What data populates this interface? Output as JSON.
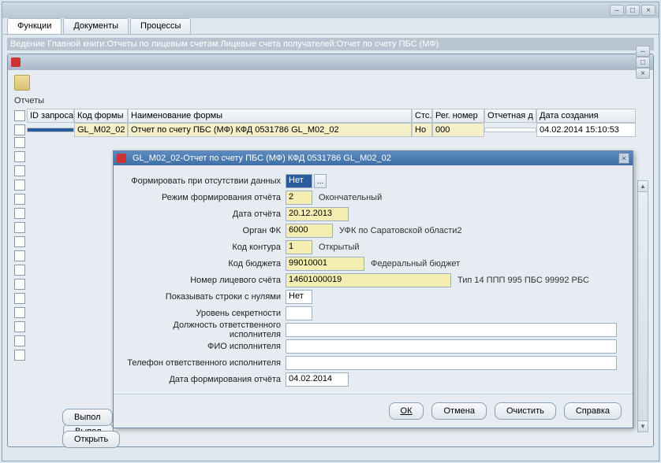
{
  "outer_window": {
    "title": ""
  },
  "tabs": [
    {
      "label": "Функции",
      "active": true
    },
    {
      "label": "Документы",
      "active": false
    },
    {
      "label": "Процессы",
      "active": false
    }
  ],
  "breadcrumb": "Ведение Главной книги:Отчеты по лицевым счетам:Лицевые счета получателей:Отчет по счету ПБС (МФ)",
  "inner_window": {
    "title": ""
  },
  "section_title": "Отчеты",
  "grid": {
    "headers": {
      "id": "ID запроса",
      "code": "Код формы",
      "name": "Наименование формы",
      "status": "Стс.",
      "reg": "Рег. номер",
      "rdate": "Отчетная д",
      "cdate": "Дата создания"
    },
    "row": {
      "id": "",
      "code": "GL_M02_02",
      "name": "Отчет по счету ПБС (МФ) КФД 0531786 GL_M02_02",
      "status": "Но",
      "reg": "000",
      "rdate": "",
      "cdate": "04.02.2014 15:10:53"
    }
  },
  "dialog": {
    "title": "GL_M02_02-Отчет по счету ПБС (МФ) КФД 0531786 GL_M02_02",
    "fields": {
      "form_on_absence": {
        "label": "Формировать при отсутствии данных",
        "value": "Нет"
      },
      "mode": {
        "label": "Режим формирования отчёта",
        "value": "2",
        "descr": "Окончательный"
      },
      "report_date": {
        "label": "Дата отчёта",
        "value": "20.12.2013"
      },
      "organ": {
        "label": "Орган ФК",
        "value": "6000",
        "descr": "УФК по Саратовской области2"
      },
      "contour": {
        "label": "Код контура",
        "value": "1",
        "descr": "Открытый"
      },
      "budget": {
        "label": "Код бюджета",
        "value": "99010001",
        "descr": "Федеральный бюджет"
      },
      "account": {
        "label": "Номер лицевого счёта",
        "value": "14601000019",
        "descr": "Тип 14 ППП 995 ПБС 99992 РБС"
      },
      "show_zero": {
        "label": "Показывать строки с нулями",
        "value": "Нет"
      },
      "secrecy": {
        "label": "Уровень секретности",
        "value": ""
      },
      "exec_post": {
        "label": "Должность ответственного исполнителя",
        "value": ""
      },
      "exec_name": {
        "label": "ФИО исполнителя",
        "value": ""
      },
      "exec_phone": {
        "label": "Телефон ответственного исполнителя",
        "value": ""
      },
      "form_date": {
        "label": "Дата формирования отчёта",
        "value": "04.02.2014"
      }
    },
    "buttons": {
      "ok": "ОК",
      "cancel": "Отмена",
      "clear": "Очистить",
      "help": "Справка"
    }
  },
  "bottom_buttons": {
    "exec": "Выпол",
    "open": "Открыть"
  }
}
